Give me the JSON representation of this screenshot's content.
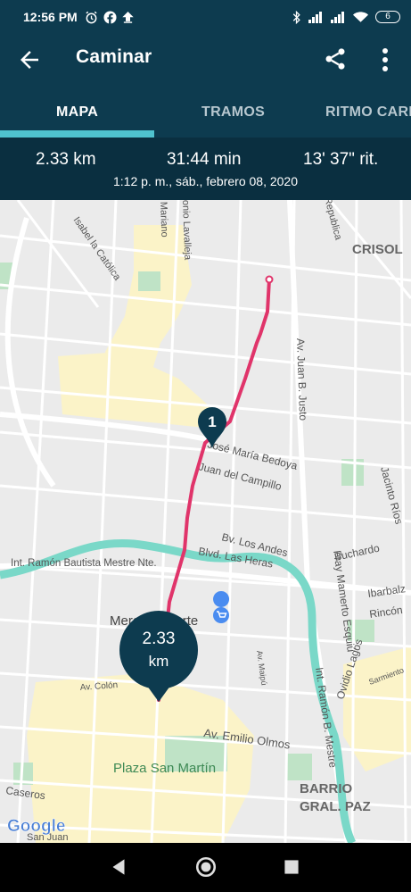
{
  "status_bar": {
    "time": "12:56 PM",
    "battery": "6",
    "icons": [
      "alarm-icon",
      "facebook-icon",
      "upload-icon",
      "bluetooth-icon",
      "signal-icon",
      "signal-icon",
      "wifi-icon",
      "battery-icon"
    ]
  },
  "app_bar": {
    "title": "Caminar",
    "icons": [
      "back-arrow-icon",
      "share-icon",
      "more-vert-icon"
    ]
  },
  "tabs": [
    {
      "label": "MAPA",
      "active": true
    },
    {
      "label": "TRAMOS",
      "active": false
    },
    {
      "label": "RITMO CARD",
      "active": false
    }
  ],
  "summary": {
    "distance": "2.33 km",
    "duration": "31:44 min",
    "pace": "13' 37\" rit.",
    "datetime": "1:12 p. m., sáb., febrero 08, 2020"
  },
  "map": {
    "route_color": "#e0346a",
    "marker_color": "#0d3b4f",
    "park_color": "#bfe3c6",
    "river_color": "#7ad8c8",
    "urban_color": "#fbf3c8",
    "km_marker": "1",
    "end_marker": {
      "value": "2.33",
      "unit": "km"
    },
    "labels": {
      "isabel": "Isabel la Católica",
      "mariano": "Mariano",
      "lavalleja": "onio Lavalleja",
      "republica": "Republica",
      "crisol": "CRISOL",
      "juan_b_justo": "Av. Juan B. Justo",
      "bedoya": "José María Bedoya",
      "campillo": "Juan del Campillo",
      "jacinto": "Jacinto Ríos",
      "buchardo": "Buchardo",
      "los_andes": "Bv. Los Andes",
      "las_heras": "Blvd. Las Heras",
      "mestre_nte": "Int. Ramón Bautista Mestre Nte.",
      "esquiu": "Fray Mamerto Esquiú",
      "ibarbalz": "Ibarbalz",
      "rincon": "Rincón",
      "mercado": "Mercado Norte",
      "colon": "Av. Colón",
      "maipu": "Av. Maipú",
      "mestre_b": "Int. Ramón B. Mestre",
      "sarmiento": "Sarmiento",
      "ovidio": "Ovidio Lagos",
      "emilio_olmos": "Av. Emilio Olmos",
      "plaza": "Plaza San Martín",
      "caseros": "Caseros",
      "san_juan": "San Juan",
      "barrio1": "BARRIO",
      "barrio2": "GRAL. PAZ",
      "google": "Google"
    }
  }
}
